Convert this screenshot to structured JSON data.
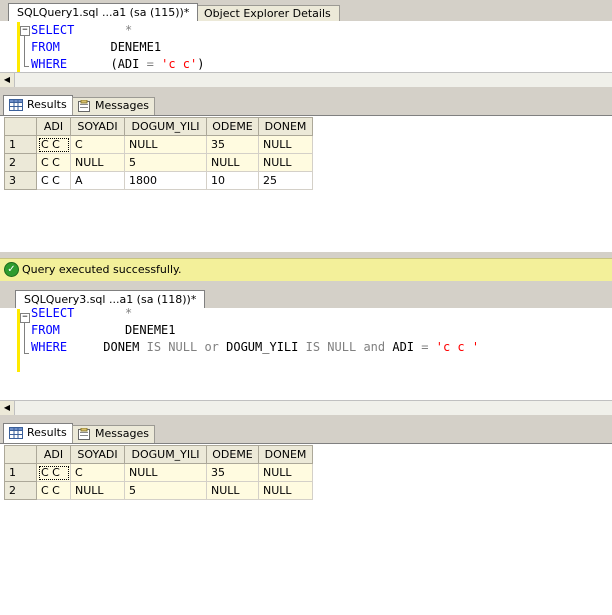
{
  "pane1": {
    "tabs": [
      {
        "label": "SQLQuery1.sql ...a1 (sa (115))*",
        "active": true
      },
      {
        "label": "Object Explorer Details",
        "active": false
      }
    ],
    "code": {
      "line1": {
        "kw": "SELECT",
        "rest": "*"
      },
      "line2": {
        "kw": "FROM",
        "table": "DENEME1"
      },
      "line3": {
        "kw": "WHERE",
        "open": "(ADI",
        "eq": "=",
        "str": "'c c'",
        "close": ")"
      }
    },
    "result_tabs": {
      "results": "Results",
      "messages": "Messages"
    },
    "grid": {
      "columns": [
        "ADI",
        "SOYADI",
        "DOGUM_YILI",
        "ODEME",
        "DONEM"
      ],
      "rows": [
        {
          "num": "1",
          "cells": [
            "C C",
            "C",
            "NULL",
            "35",
            "NULL"
          ]
        },
        {
          "num": "2",
          "cells": [
            "C C",
            "NULL",
            "5",
            "NULL",
            "NULL"
          ]
        },
        {
          "num": "3",
          "cells": [
            "C C",
            "A",
            "1800",
            "10",
            "25"
          ]
        }
      ]
    },
    "status": "Query executed successfully."
  },
  "pane2": {
    "tabs": [
      {
        "label": "SQLQuery3.sql ...a1 (sa (118))*",
        "active": true
      }
    ],
    "code": {
      "line1": {
        "kw": "SELECT",
        "rest": "*"
      },
      "line2": {
        "kw": "FROM",
        "table": "DENEME1"
      },
      "line3": {
        "kw": "WHERE",
        "c1": "DONEM",
        "is1": "IS",
        "null1": "NULL",
        "or": "or",
        "c2": "DOGUM_YILI",
        "is2": "IS",
        "null2": "NULL",
        "and": "and",
        "c3": "ADI",
        "eq": "=",
        "str": "'c c '"
      }
    },
    "result_tabs": {
      "results": "Results",
      "messages": "Messages"
    },
    "grid": {
      "columns": [
        "ADI",
        "SOYADI",
        "DOGUM_YILI",
        "ODEME",
        "DONEM"
      ],
      "rows": [
        {
          "num": "1",
          "cells": [
            "C C",
            "C",
            "NULL",
            "35",
            "NULL"
          ]
        },
        {
          "num": "2",
          "cells": [
            "C C",
            "NULL",
            "5",
            "NULL",
            "NULL"
          ]
        }
      ]
    }
  },
  "colors": {
    "keyword": "#0000ff",
    "string": "#ff0000",
    "operator": "#808080",
    "status_bg": "#f3f09a",
    "success": "#2e9b2e"
  },
  "icons": [
    "grid-icon",
    "messages-icon",
    "checkmark-icon",
    "scroll-left-arrow-icon",
    "fold-collapse-icon"
  ]
}
